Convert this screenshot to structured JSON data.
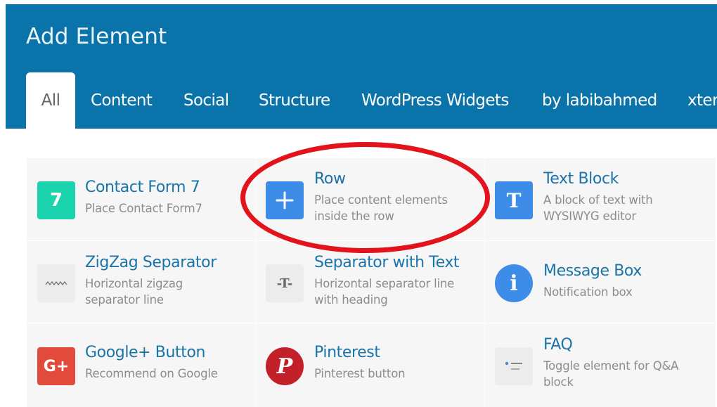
{
  "header": {
    "title": "Add Element",
    "tabs": [
      {
        "label": "All",
        "active": true
      },
      {
        "label": "Content"
      },
      {
        "label": "Social"
      },
      {
        "label": "Structure"
      },
      {
        "label": "WordPress Widgets"
      },
      {
        "label": "by labibahmed"
      },
      {
        "label": "xter"
      }
    ]
  },
  "colors": {
    "header_bg": "#0a73aa",
    "title_color": "#1a74a8",
    "highlight": "#e3131b"
  },
  "elements": [
    {
      "title": "Contact Form 7",
      "desc": "Place Contact Form7",
      "icon": "contact-form-7-icon",
      "glyph": "7"
    },
    {
      "title": "Row",
      "desc": "Place content elements inside the row",
      "icon": "row-plus-icon",
      "glyph": "+"
    },
    {
      "title": "Text Block",
      "desc": "A block of text with WYSIWYG editor",
      "icon": "text-block-icon",
      "glyph": "T"
    },
    {
      "title": "ZigZag Separator",
      "desc": "Horizontal zigzag separator line",
      "icon": "zigzag-separator-icon",
      "glyph": ""
    },
    {
      "title": "Separator with Text",
      "desc": "Horizontal separator line with heading",
      "icon": "separator-text-icon",
      "glyph": "-T-"
    },
    {
      "title": "Message Box",
      "desc": "Notification box",
      "icon": "message-box-icon",
      "glyph": "i"
    },
    {
      "title": "Google+ Button",
      "desc": "Recommend on Google",
      "icon": "google-plus-icon",
      "glyph": "G+"
    },
    {
      "title": "Pinterest",
      "desc": "Pinterest button",
      "icon": "pinterest-icon",
      "glyph": "P"
    },
    {
      "title": "FAQ",
      "desc": "Toggle element for Q&A block",
      "icon": "faq-toggle-icon",
      "glyph": ""
    }
  ]
}
